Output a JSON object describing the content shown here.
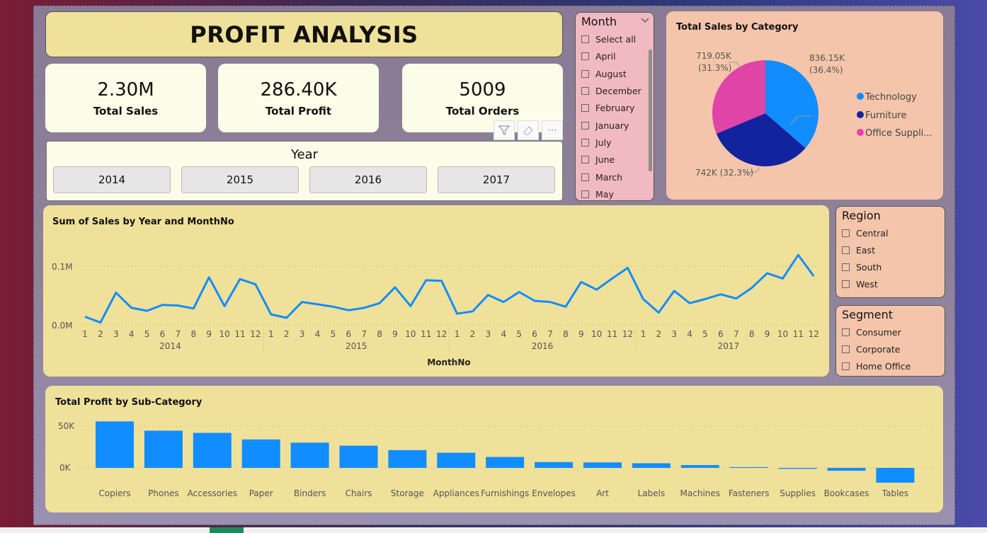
{
  "title": "PROFIT ANALYSIS",
  "kpis": [
    {
      "value": "2.30M",
      "label": "Total Sales"
    },
    {
      "value": "286.40K",
      "label": "Total Profit"
    },
    {
      "value": "5009",
      "label": "Total Orders"
    }
  ],
  "year_slicer": {
    "title": "Year",
    "options": [
      "2014",
      "2015",
      "2016",
      "2017"
    ]
  },
  "month_slicer": {
    "title": "Month",
    "options": [
      "Select all",
      "April",
      "August",
      "December",
      "February",
      "January",
      "July",
      "June",
      "March",
      "May"
    ]
  },
  "region_slicer": {
    "title": "Region",
    "options": [
      "Central",
      "East",
      "South",
      "West"
    ]
  },
  "segment_slicer": {
    "title": "Segment",
    "options": [
      "Consumer",
      "Corporate",
      "Home Office"
    ]
  },
  "toolbar": {
    "icons": [
      "filter-icon",
      "eraser-icon",
      "more-options-icon"
    ]
  },
  "colors": {
    "technology": "#118dff",
    "furniture": "#12239e",
    "office": "#e044a7",
    "bar": "#118dff",
    "line": "#118dff"
  },
  "chart_data": [
    {
      "type": "pie",
      "title": "Total Sales by Category",
      "slices": [
        {
          "name": "Technology",
          "value": 836.15,
          "label": "836.15K",
          "pct": "(36.4%)"
        },
        {
          "name": "Furniture",
          "value": 742,
          "label": "742K (32.3%)",
          "pct": ""
        },
        {
          "name": "Office Supplies",
          "value": 719.05,
          "label": "719.05K",
          "pct": "(31.3%)"
        }
      ],
      "legend": [
        "Technology",
        "Furniture",
        "Office Suppli..."
      ],
      "legend_position": "right"
    },
    {
      "type": "line",
      "title": "Sum of Sales by Year and MonthNo",
      "xlabel": "MonthNo",
      "ylabel": "",
      "years": [
        "2014",
        "2015",
        "2016",
        "2017"
      ],
      "month_ticks": [
        "1",
        "2",
        "3",
        "4",
        "5",
        "6",
        "7",
        "8",
        "9",
        "10",
        "11",
        "12"
      ],
      "y_ticks": [
        "0.0M",
        "0.1M"
      ],
      "ylim": [
        0,
        0.12
      ],
      "values": [
        0.014,
        0.004,
        0.055,
        0.029,
        0.024,
        0.034,
        0.033,
        0.028,
        0.081,
        0.032,
        0.078,
        0.069,
        0.018,
        0.012,
        0.039,
        0.035,
        0.031,
        0.025,
        0.029,
        0.037,
        0.064,
        0.032,
        0.076,
        0.075,
        0.019,
        0.023,
        0.051,
        0.039,
        0.056,
        0.041,
        0.039,
        0.031,
        0.073,
        0.06,
        0.079,
        0.097,
        0.044,
        0.021,
        0.058,
        0.037,
        0.044,
        0.052,
        0.045,
        0.063,
        0.088,
        0.079,
        0.119,
        0.083
      ]
    },
    {
      "type": "bar",
      "title": "Total Profit by Sub-Category",
      "categories": [
        "Copiers",
        "Phones",
        "Accessories",
        "Paper",
        "Binders",
        "Chairs",
        "Storage",
        "Appliances",
        "Furnishings",
        "Envelopes",
        "Art",
        "Labels",
        "Machines",
        "Fasteners",
        "Supplies",
        "Bookcases",
        "Tables"
      ],
      "values": [
        55618,
        44516,
        41937,
        34054,
        30222,
        26590,
        21279,
        18138,
        13059,
        6964,
        6528,
        5546,
        3385,
        950,
        -1189,
        -3473,
        -17725
      ],
      "y_ticks": [
        "0K",
        "50K"
      ],
      "ylim": [
        -20000,
        60000
      ]
    }
  ]
}
